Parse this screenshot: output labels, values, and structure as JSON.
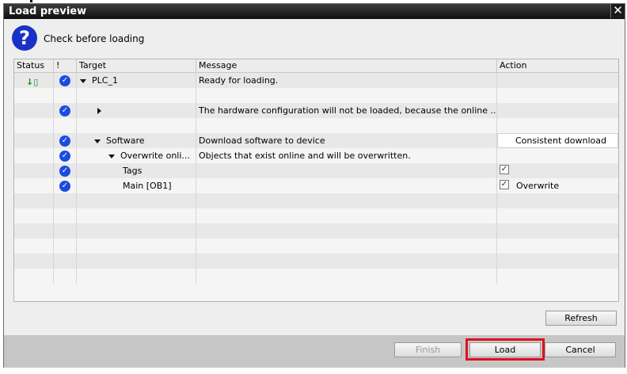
{
  "window": {
    "title": "Load preview",
    "close_glyph": "✕"
  },
  "header": {
    "icon": "question-icon",
    "icon_glyph": "?",
    "text": "Check before loading"
  },
  "table": {
    "columns": [
      "Status",
      "!",
      "Target",
      "Message",
      "Action"
    ],
    "rows": [
      {
        "status_icon": "download-icon",
        "check": true,
        "expander": "down",
        "target": "PLC_1",
        "message": "Ready for loading.",
        "action": ""
      },
      {
        "status_icon": "",
        "check": false,
        "expander": "",
        "target": "",
        "message": "",
        "action": ""
      },
      {
        "status_icon": "",
        "check": true,
        "expander": "right",
        "target": "",
        "message": "The hardware configuration will not be loaded, because the online ...",
        "action": ""
      },
      {
        "status_icon": "",
        "check": false,
        "expander": "",
        "target": "",
        "message": "",
        "action": ""
      },
      {
        "status_icon": "",
        "check": true,
        "expander": "down",
        "target": "Software",
        "message": "Download software to device",
        "action": "Consistent download"
      },
      {
        "status_icon": "",
        "check": true,
        "expander": "down",
        "target": "Overwrite onli...",
        "message": "Objects that exist online and will be overwritten.",
        "action": ""
      },
      {
        "status_icon": "",
        "check": true,
        "expander": "",
        "target": "Tags",
        "message": "",
        "action": "",
        "checkbox": true
      },
      {
        "status_icon": "",
        "check": true,
        "expander": "",
        "target": "Main [OB1]",
        "message": "",
        "action": "Overwrite",
        "checkbox": true
      }
    ]
  },
  "buttons": {
    "refresh": "Refresh",
    "finish": "Finish",
    "load": "Load",
    "cancel": "Cancel"
  },
  "colors": {
    "accent": "#1b4ce0",
    "highlight": "#e0101f",
    "titlebar": "#1a1a1a"
  }
}
